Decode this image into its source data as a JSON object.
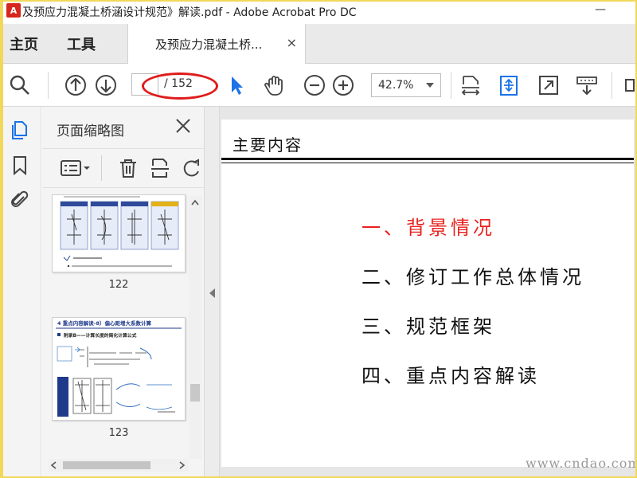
{
  "window": {
    "title": "及预应力混凝土桥涵设计规范》解读.pdf - Adobe Acrobat Pro DC",
    "minimize_glyph": "—"
  },
  "nav": {
    "home": "主页",
    "tools": "工具",
    "doc_tab": "及预应力混凝土桥...",
    "tab_close": "×"
  },
  "toolbar": {
    "page_current": "",
    "page_total": "/ 152",
    "zoom": "42.7%"
  },
  "thumbnail_panel": {
    "title": "页面缩略图",
    "pages": [
      {
        "number": "122"
      },
      {
        "number": "123"
      }
    ],
    "thumb123": {
      "heading": "4 重点内容解读-8）偏心距增大系数计算",
      "subheading": "附录B——计算长度的简化计算公式"
    }
  },
  "document": {
    "heading": "主要内容",
    "toc": [
      {
        "label": "一、背景情况",
        "active": true
      },
      {
        "label": "二、修订工作总体情况",
        "active": false
      },
      {
        "label": "三、规范框架",
        "active": false
      },
      {
        "label": "四、重点内容解读",
        "active": false
      }
    ],
    "watermark": "www.cndao.com"
  },
  "colors": {
    "accent_red": "#e8221f",
    "select_blue": "#1a73e8"
  }
}
